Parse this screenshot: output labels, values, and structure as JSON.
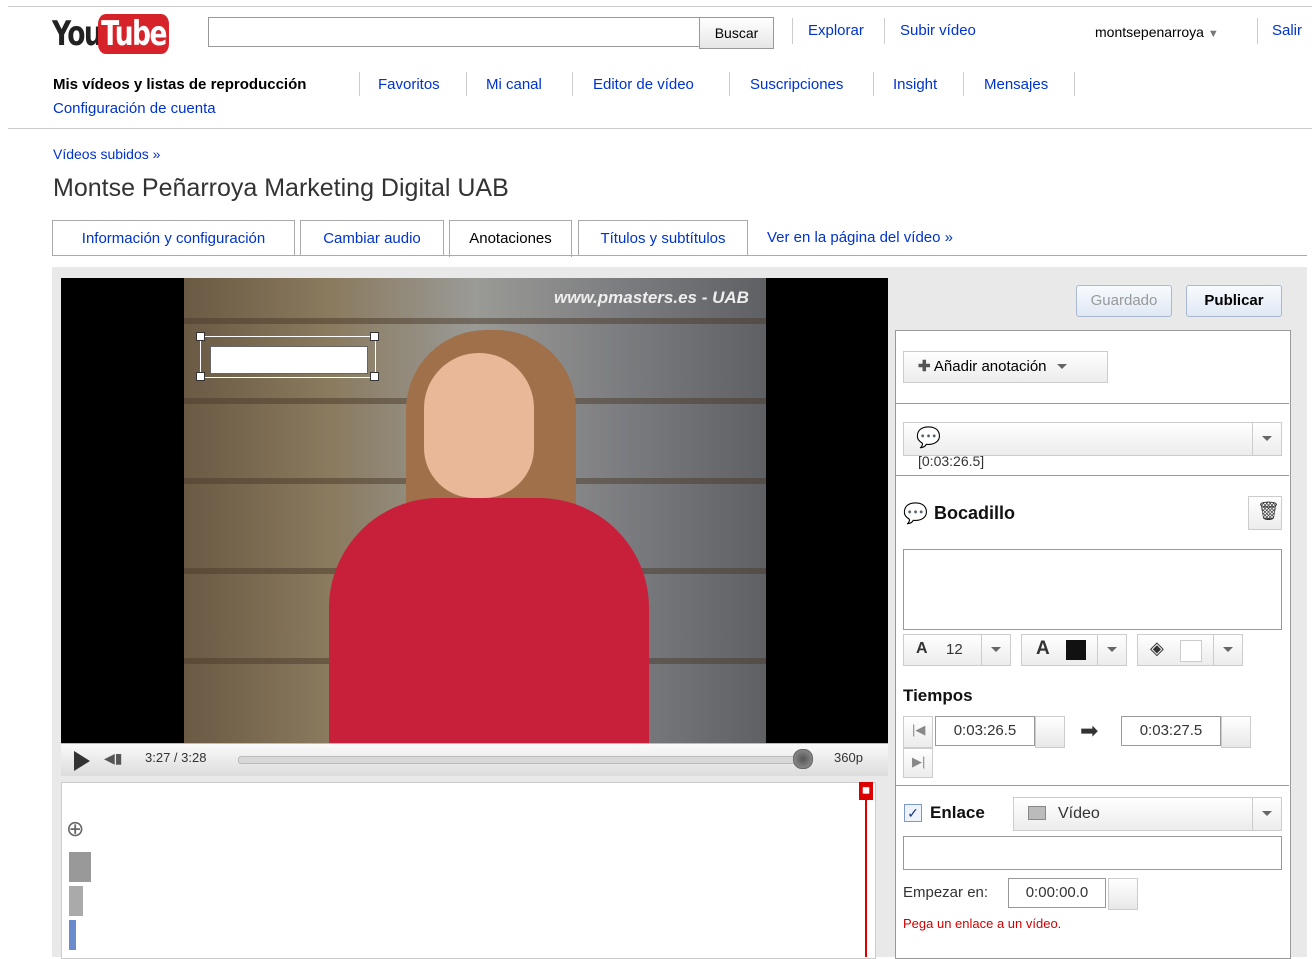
{
  "header": {
    "logo_you": "You",
    "logo_tube": "Tube",
    "search_placeholder": "",
    "search_button": "Buscar",
    "links": [
      "Explorar",
      "Subir vídeo"
    ],
    "username": "montsepenarroya",
    "logout": "Salir"
  },
  "subnav": {
    "items": [
      "Mis vídeos y listas de reproducción",
      "Favoritos",
      "Mi canal",
      "Editor de vídeo",
      "Suscripciones",
      "Insight",
      "Mensajes"
    ],
    "account": "Configuración de cuenta"
  },
  "page": {
    "breadcrumb": "Vídeos subidos »",
    "title": "Montse Peñarroya Marketing Digital UAB",
    "tabs": [
      "Información y configuración",
      "Cambiar audio",
      "Anotaciones",
      "Títulos y subtítulos"
    ],
    "view_link": "Ver en la página del vídeo »"
  },
  "player": {
    "watermark": "www.pmasters.es - UAB",
    "time": "3:27 / 3:28",
    "quality": "360p",
    "progress": 0.99
  },
  "annotations": {
    "saved_button": "Guardado",
    "publish_button": "Publicar",
    "add_button": "Añadir anotación",
    "selected_timestamp": "[0:03:26.5]",
    "type_label": "Bocadillo",
    "font_size": "12",
    "text_color": "#111111",
    "bg_color": "#ffffff",
    "times_label": "Tiempos",
    "start_time": "0:03:26.5",
    "end_time": "0:03:27.5",
    "link_label": "Enlace",
    "link_checked": true,
    "link_type": "Vídeo",
    "link_url": "",
    "start_at_label": "Empezar en:",
    "start_at_value": "0:00:00.0",
    "error": "Pega un enlace a un vídeo."
  }
}
